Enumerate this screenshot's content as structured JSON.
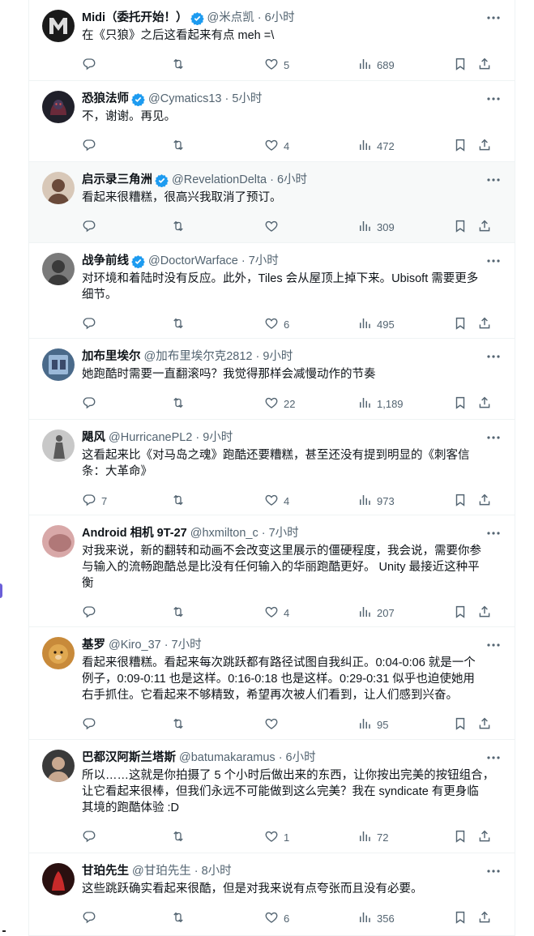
{
  "colors": {
    "accent": "#1d9bf0",
    "verified": "#1d9bf0",
    "muted": "#536471",
    "text": "#0f1419",
    "border": "#eff3f4"
  },
  "tweets": [
    {
      "name": "Midi（委托开始！）",
      "verified": true,
      "handle": "@米点凯",
      "time": "6小时",
      "lines": [
        "在《只狼》之后这看起来有点 meh =\\"
      ],
      "replies": "",
      "retweets": "",
      "likes": "5",
      "views": "689"
    },
    {
      "name": "恐狼法师",
      "verified": true,
      "handle": "@Cymatics13",
      "time": "5小时",
      "lines": [
        "不，谢谢。再见。"
      ],
      "replies": "",
      "retweets": "",
      "likes": "4",
      "views": "472"
    },
    {
      "name": "启示录三角洲",
      "verified": true,
      "handle": "@RevelationDelta",
      "time": "6小时",
      "lines": [
        "看起来很糟糕，很高兴我取消了预订。"
      ],
      "replies": "",
      "retweets": "",
      "likes": "",
      "views": "309"
    },
    {
      "name": "战争前线",
      "verified": true,
      "handle": "@DoctorWarface",
      "time": "7小时",
      "lines": [
        "对环境和着陆时没有反应。此外，Tiles 会从屋顶上掉下来。Ubisoft 需要更多",
        "细节。"
      ],
      "replies": "",
      "retweets": "",
      "likes": "6",
      "views": "495"
    },
    {
      "name": "加布里埃尔",
      "verified": false,
      "handle": "@加布里埃尔克2812",
      "time": "9小时",
      "lines": [
        "她跑酷时需要一直翻滚吗？我觉得那样会减慢动作的节奏"
      ],
      "replies": "",
      "retweets": "",
      "likes": "22",
      "views": "1,189"
    },
    {
      "name": "飓风",
      "verified": false,
      "handle": "@HurricanePL2",
      "time": "9小时",
      "lines": [
        "这看起来比《对马岛之魂》跑酷还要糟糕，甚至还没有提到明显的《刺客信",
        "条：大革命》"
      ],
      "replies": "7",
      "retweets": "",
      "likes": "4",
      "views": "973"
    },
    {
      "name": "Android 相机 9T-27",
      "verified": false,
      "handle": "@hxmilton_c",
      "time": "7小时",
      "lines": [
        "对我来说，新的翻转和动画不会改变这里展示的僵硬程度，我会说，需要你参",
        "与输入的流畅跑酷总是比没有任何输入的华丽跑酷更好。 Unity 最接近这种平",
        "衡"
      ],
      "replies": "",
      "retweets": "",
      "likes": "4",
      "views": "207"
    },
    {
      "name": "基罗",
      "verified": false,
      "handle": "@Kiro_37",
      "time": "7小时",
      "lines": [
        "看起来很糟糕。看起来每次跳跃都有路径试图自我纠正。0:04-0:06 就是一个",
        "例子，0:09-0:11 也是这样。0:16-0:18 也是这样。0:29-0:31 似乎也迫使她用",
        "右手抓住。它看起来不够精致，希望再次被人们看到，让人们感到兴奋。"
      ],
      "replies": "",
      "retweets": "",
      "likes": "",
      "views": "95"
    },
    {
      "name": "巴都汉阿斯兰塔斯",
      "verified": false,
      "handle": "@batumakaramus",
      "time": "6小时",
      "lines": [
        "所以……这就是你拍摄了 5 个小时后做出来的东西，让你按出完美的按钮组合，",
        "让它看起来很棒，但我们永远不可能做到这么完美？我在 syndicate 有更身临",
        "其境的跑酷体验 :D"
      ],
      "replies": "",
      "retweets": "",
      "likes": "1",
      "views": "72"
    },
    {
      "name": "甘珀先生",
      "verified": false,
      "handle": "@甘珀先生",
      "time": "8小时",
      "lines": [
        "这些跳跃确实看起来很酷，但是对我来说有点夸张而且没有必要。"
      ],
      "replies": "",
      "retweets": "",
      "likes": "6",
      "views": "356"
    }
  ]
}
